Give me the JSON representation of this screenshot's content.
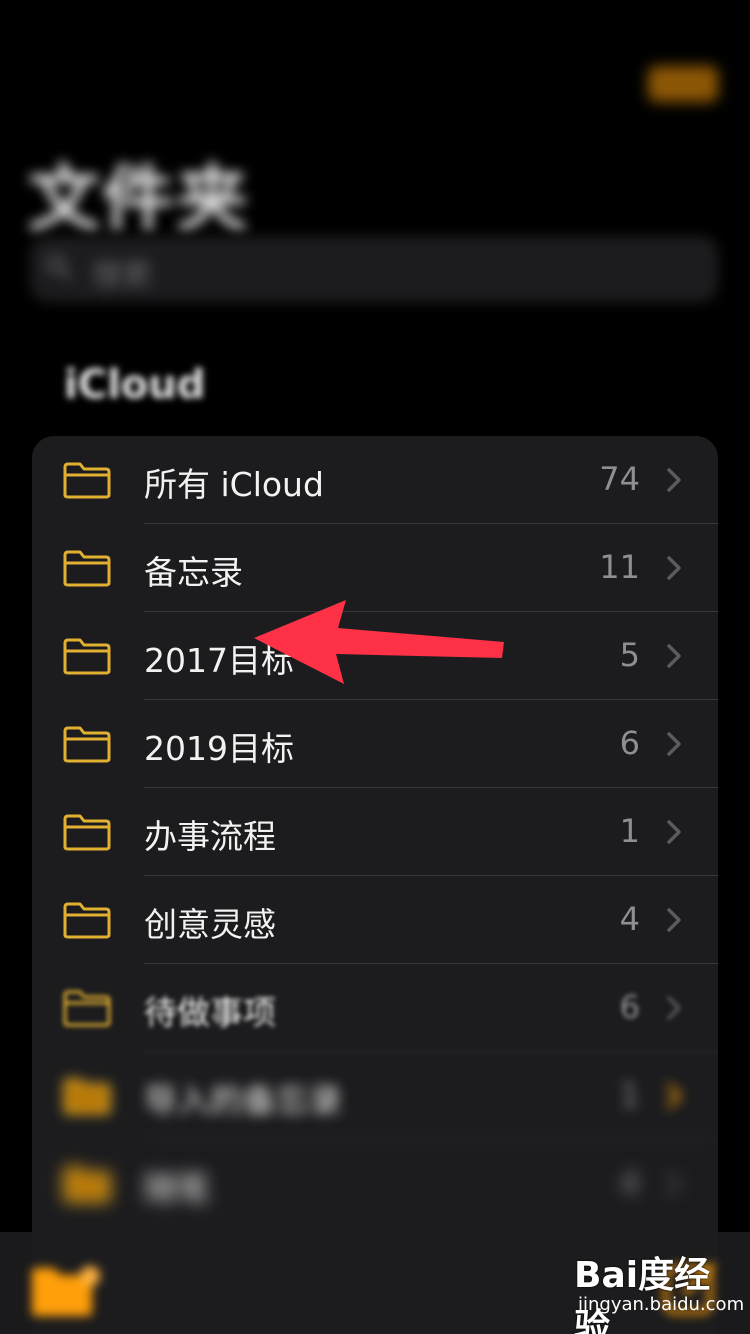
{
  "status_bar": {
    "carrier": "",
    "time": "",
    "battery": ""
  },
  "header": {
    "edit_label": "",
    "title": "文件夹",
    "search_placeholder": "搜索"
  },
  "section": {
    "title": "iCloud"
  },
  "folders": [
    {
      "name": "所有 iCloud",
      "count": "74"
    },
    {
      "name": "备忘录",
      "count": "11"
    },
    {
      "name": "2017目标",
      "count": "5"
    },
    {
      "name": "2019目标",
      "count": "6"
    },
    {
      "name": "办事流程",
      "count": "1"
    },
    {
      "name": "创意灵感",
      "count": "4"
    },
    {
      "name": "待做事项",
      "count": "6"
    },
    {
      "name": "导入的备忘录",
      "count": "1"
    },
    {
      "name": "随笔",
      "count": "4"
    }
  ],
  "colors": {
    "accent": "#ff9f0a",
    "folder_icon": "#e2b031",
    "annotation_arrow": "#ff3146"
  },
  "watermark": {
    "logo": "Bai度经验",
    "url": "jingyan.baidu.com"
  }
}
